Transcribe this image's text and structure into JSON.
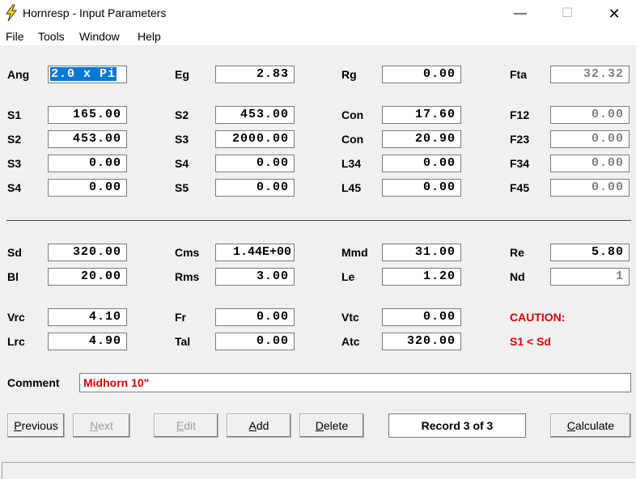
{
  "window": {
    "title": "Hornresp - Input Parameters",
    "minimize": "—",
    "maximize": "☐",
    "close": "✕"
  },
  "menu": [
    "File",
    "Tools",
    "Window",
    "Help"
  ],
  "rows": {
    "ang": {
      "label": "Ang",
      "value": "2.0 x Pi"
    },
    "eg": {
      "label": "Eg",
      "value": "2.83"
    },
    "rg": {
      "label": "Rg",
      "value": "0.00"
    },
    "fta": {
      "label": "Fta",
      "value": "32.32"
    },
    "s1": {
      "label": "S1",
      "value": "165.00"
    },
    "s2a": {
      "label": "S2",
      "value": "453.00"
    },
    "con1": {
      "label": "Con",
      "value": "17.60"
    },
    "f12": {
      "label": "F12",
      "value": "0.00"
    },
    "s2b": {
      "label": "S2",
      "value": "453.00"
    },
    "s3a": {
      "label": "S3",
      "value": "2000.00"
    },
    "con2": {
      "label": "Con",
      "value": "20.90"
    },
    "f23": {
      "label": "F23",
      "value": "0.00"
    },
    "s3b": {
      "label": "S3",
      "value": "0.00"
    },
    "s4a": {
      "label": "S4",
      "value": "0.00"
    },
    "l34": {
      "label": "L34",
      "value": "0.00"
    },
    "f34": {
      "label": "F34",
      "value": "0.00"
    },
    "s4b": {
      "label": "S4",
      "value": "0.00"
    },
    "s5": {
      "label": "S5",
      "value": "0.00"
    },
    "l45": {
      "label": "L45",
      "value": "0.00"
    },
    "f45": {
      "label": "F45",
      "value": "0.00"
    },
    "sd": {
      "label": "Sd",
      "value": "320.00"
    },
    "cms": {
      "label": "Cms",
      "value": "1.44E+00"
    },
    "mmd": {
      "label": "Mmd",
      "value": "31.00"
    },
    "re": {
      "label": "Re",
      "value": "5.80"
    },
    "bl": {
      "label": "Bl",
      "value": "20.00"
    },
    "rms": {
      "label": "Rms",
      "value": "3.00"
    },
    "le": {
      "label": "Le",
      "value": "1.20"
    },
    "nd": {
      "label": "Nd",
      "value": "1"
    },
    "vrc": {
      "label": "Vrc",
      "value": "4.10"
    },
    "fr": {
      "label": "Fr",
      "value": "0.00"
    },
    "vtc": {
      "label": "Vtc",
      "value": "0.00"
    },
    "lrc": {
      "label": "Lrc",
      "value": "4.90"
    },
    "tal": {
      "label": "Tal",
      "value": "0.00"
    },
    "atc": {
      "label": "Atc",
      "value": "320.00"
    }
  },
  "caution": {
    "title": "CAUTION:",
    "message": "S1 < Sd"
  },
  "comment": {
    "label": "Comment",
    "value": "Midhorn 10\""
  },
  "buttons": {
    "previous": {
      "first": "P",
      "rest": "revious"
    },
    "next": {
      "first": "N",
      "rest": "ext"
    },
    "edit": {
      "first": "E",
      "rest": "dit"
    },
    "add": {
      "first": "A",
      "rest": "dd"
    },
    "delete": {
      "first": "D",
      "rest": "elete"
    },
    "calculate": {
      "first": "C",
      "rest": "alculate"
    }
  },
  "record": "Record 3 of 3",
  "colors": {
    "selection": "#0078d7",
    "warning": "#e00000",
    "readonly": "#7f7f7f"
  }
}
